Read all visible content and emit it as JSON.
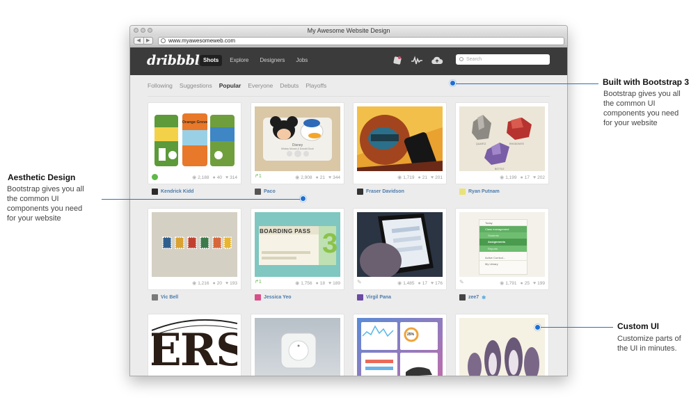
{
  "browser": {
    "window_title": "My Awesome Website Design",
    "url": "www.myawesomeweb.com",
    "back_glyph": "◀",
    "forward_glyph": "▶"
  },
  "site": {
    "logo": "dribbble",
    "nav": [
      "Shots",
      "Explore",
      "Designers",
      "Jobs"
    ],
    "active_nav": "Shots",
    "icons": [
      "notifications-icon",
      "activity-icon",
      "upload-cloud-icon"
    ],
    "search_placeholder": "Search",
    "filters": [
      "Following",
      "Suggestions",
      "Popular",
      "Everyone",
      "Debuts",
      "Playoffs"
    ],
    "active_filter": "Popular"
  },
  "shots": [
    {
      "author": "Kendrick Kidd",
      "views": "2,188",
      "comments": "40",
      "likes": "314",
      "left": "circle"
    },
    {
      "author": "Paco",
      "views": "2,908",
      "comments": "21",
      "likes": "344",
      "left": "rebound",
      "left_text": "1"
    },
    {
      "author": "Fraser Davidson",
      "views": "1,719",
      "comments": "21",
      "likes": "201",
      "left": ""
    },
    {
      "author": "Ryan Putnam",
      "views": "1,199",
      "comments": "17",
      "likes": "202",
      "left": ""
    },
    {
      "author": "Vic Bell",
      "views": "1,216",
      "comments": "20",
      "likes": "193",
      "left": ""
    },
    {
      "author": "Jessica Yeo",
      "views": "1,756",
      "comments": "18",
      "likes": "189",
      "left": "rebound",
      "left_text": "1"
    },
    {
      "author": "Virgil Pana",
      "views": "1,485",
      "comments": "17",
      "likes": "176",
      "left": "clip"
    },
    {
      "author": "zee7",
      "views": "1,791",
      "comments": "25",
      "likes": "199",
      "left": "clip",
      "author_badge": "✻"
    },
    {
      "author": "",
      "views": "",
      "comments": "",
      "likes": ""
    },
    {
      "author": "",
      "views": "",
      "comments": "",
      "likes": ""
    },
    {
      "author": "",
      "views": "",
      "comments": "",
      "likes": ""
    },
    {
      "author": "",
      "views": "",
      "comments": "",
      "likes": ""
    }
  ],
  "thumb_text": {
    "cans": "Orange Grove",
    "disney": "Disney",
    "disney_sub": "Mickey Mouse & Donald Duck",
    "boarding": "BOARDING PASS",
    "boarding_num": "3",
    "minerals": [
      "QUARTZ",
      "RHODONITE",
      "BOTTLE"
    ],
    "todo": [
      "Today",
      "Class management",
      "Students",
      "Assignments",
      "Reports",
      "Active Curricul...",
      "My Library"
    ],
    "stats_pct": "25%",
    "typo": "ERS"
  },
  "annotations": [
    {
      "title": "Built with Bootstrap 3",
      "lines": [
        "Bootstrap gives you all",
        "the common UI",
        "components you need",
        "for your website"
      ]
    },
    {
      "title": "Aesthetic Design",
      "lines": [
        "Bootstrap gives you all",
        "the common UI",
        "components you need",
        "for your website"
      ]
    },
    {
      "title": "Custom UI",
      "lines": [
        "Customize parts of",
        "the UI in minutes."
      ]
    }
  ],
  "colors": {
    "nav_bg": "#3b3b3b",
    "author_link": "#4b7bab",
    "annotation_dot": "#1d6fd1",
    "rebound_green": "#5fb84a"
  }
}
